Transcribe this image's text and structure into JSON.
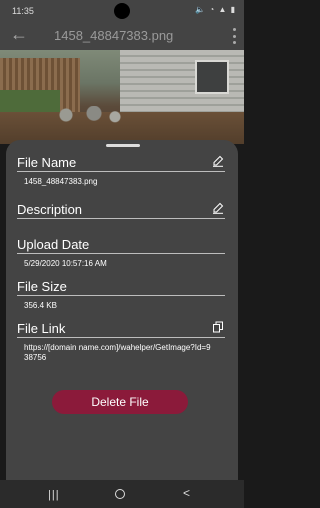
{
  "status": {
    "time": "11:35",
    "icons": "🔈 ◔ ▲ ▮"
  },
  "app_bar": {
    "title": "1458_48847383.png"
  },
  "file": {
    "name_label": "File Name",
    "name_value": "1458_48847383.png",
    "description_label": "Description",
    "description_value": "",
    "upload_label": "Upload Date",
    "upload_value": "5/29/2020 10:57:16 AM",
    "size_label": "File Size",
    "size_value": "356.4 KB",
    "link_label": "File Link",
    "link_value": "https://[domain name.com]/wahelper/GetImage?Id=938756"
  },
  "actions": {
    "delete_label": "Delete File"
  },
  "nav": {
    "recents": "|||",
    "back": "<"
  }
}
